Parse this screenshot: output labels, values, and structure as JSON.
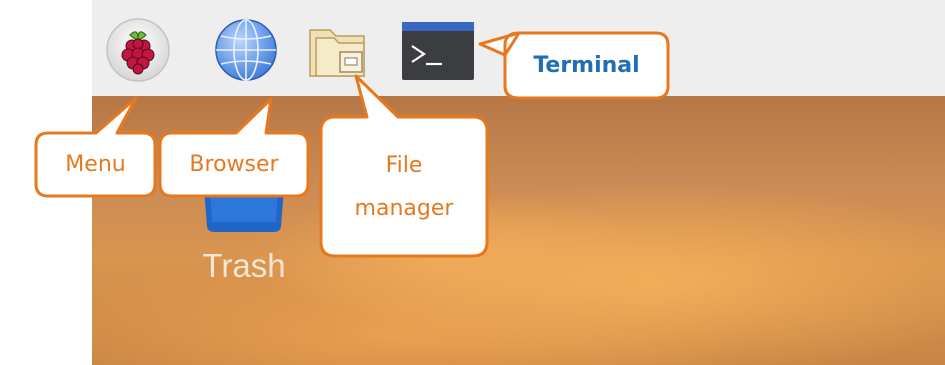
{
  "taskbar": {
    "items": [
      {
        "icon": "raspberry-icon",
        "callout": "Menu"
      },
      {
        "icon": "globe-icon",
        "callout": "Browser"
      },
      {
        "icon": "folder-icon",
        "callout_line1": "File",
        "callout_line2": "manager"
      },
      {
        "icon": "terminal-icon",
        "callout": "Terminal"
      }
    ]
  },
  "desktop": {
    "trash_label": "Trash"
  },
  "colors": {
    "callout_border": "#e67920",
    "callout_text": "#e67920",
    "terminal_callout_text": "#1f6fb5",
    "taskbar": "#eeeeee"
  }
}
